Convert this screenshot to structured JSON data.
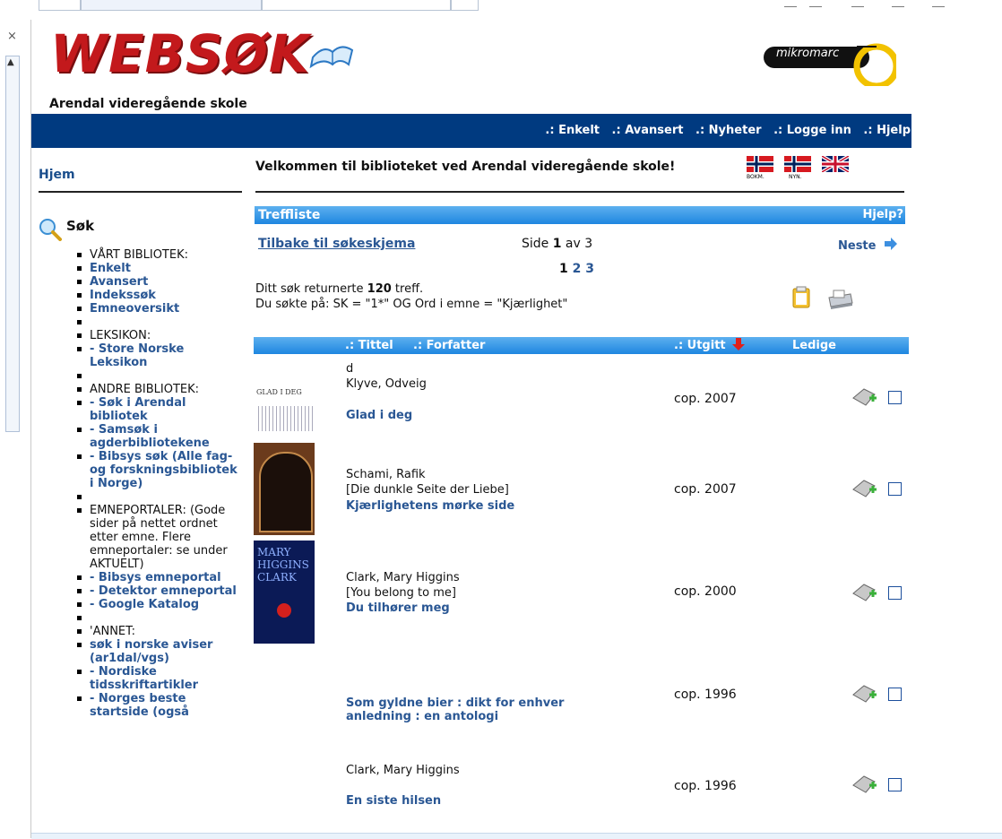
{
  "header": {
    "logo_text": "WEBSØK",
    "school_name": "Arendal videregående skole",
    "vendor_logo_text": "mikromarc"
  },
  "nav": {
    "items": [
      ".: Enkelt",
      ".: Avansert",
      ".: Nyheter",
      ".: Logge inn",
      ".: Hjelp"
    ]
  },
  "sidebar": {
    "home": "Hjem",
    "search_title": "Søk",
    "items": [
      {
        "label": "VÅRT BIBLIOTEK:",
        "kind": "text"
      },
      {
        "label": "Enkelt",
        "kind": "link"
      },
      {
        "label": "Avansert",
        "kind": "link"
      },
      {
        "label": "Indekssøk",
        "kind": "link"
      },
      {
        "label": "Emneoversikt",
        "kind": "link"
      },
      {
        "label": "",
        "kind": "blank"
      },
      {
        "label": "LEKSIKON:",
        "kind": "text"
      },
      {
        "label": "- Store Norske Leksikon",
        "kind": "link"
      },
      {
        "label": "",
        "kind": "blank"
      },
      {
        "label": "ANDRE BIBLIOTEK:",
        "kind": "text"
      },
      {
        "label": "- Søk i Arendal bibliotek",
        "kind": "link"
      },
      {
        "label": "- Samsøk i agderbibliotekene",
        "kind": "link"
      },
      {
        "label": "- Bibsys søk (Alle fag- og forskningsbibliotek i Norge)",
        "kind": "link"
      },
      {
        "label": "",
        "kind": "blank"
      },
      {
        "label": "EMNEPORTALER: (Gode sider på nettet ordnet etter emne. Flere emneportaler: se under AKTUELT)",
        "kind": "text"
      },
      {
        "label": "- Bibsys emneportal",
        "kind": "link"
      },
      {
        "label": "- Detektor emneportal",
        "kind": "link"
      },
      {
        "label": "- Google Katalog",
        "kind": "link"
      },
      {
        "label": "",
        "kind": "blank"
      },
      {
        "label": "'ANNET:",
        "kind": "text"
      },
      {
        "label": "søk i norske aviser (ar1dal/vgs)",
        "kind": "link"
      },
      {
        "label": "- Nordiske tidsskriftartikler",
        "kind": "link"
      },
      {
        "label": "- Norges beste startside (også",
        "kind": "link"
      }
    ]
  },
  "main": {
    "welcome": "Velkommen til biblioteket ved Arendal videregående skole!",
    "flag_labels": [
      "BOKM.",
      "NYN."
    ],
    "treffliste_title": "Treffliste",
    "help_link": "Hjelp?",
    "back_link": "Tilbake til søkeskjema",
    "page_prefix": "Side ",
    "page_current": "1",
    "page_suffix": " av 3",
    "next_link": "Neste",
    "pages": [
      "1",
      "2",
      "3"
    ],
    "result_count_prefix": "Ditt søk returnerte ",
    "result_count": "120",
    "result_count_suffix": " treff.",
    "query_text": "Du søkte på: SK = \"1*\" OG Ord i emne = \"Kjærlighet\"",
    "columns": {
      "title": ".: Tittel",
      "author": ".: Forfatter",
      "published": ".: Utgitt",
      "available": "Ledige"
    }
  },
  "results": [
    {
      "lines": [
        "d",
        "Klyve, Odveig"
      ],
      "title": "Glad i deg",
      "year": "cop. 2007",
      "cover_text": "GLAD I DEG"
    },
    {
      "lines": [
        "Schami, Rafik",
        "[Die dunkle Seite der Liebe]"
      ],
      "title": "Kjærlighetens mørke side",
      "year": "cop. 2007",
      "cover_text": ""
    },
    {
      "lines": [
        "Clark, Mary Higgins",
        "[You belong to me]"
      ],
      "title": "Du tilhører meg",
      "year": "cop. 2000",
      "cover_text": "MARY HIGGINS CLARK"
    },
    {
      "lines": [],
      "title": "Som gyldne bier : dikt for enhver anledning : en antologi",
      "year": "cop. 1996",
      "cover_text": ""
    },
    {
      "lines": [
        "Clark, Mary Higgins"
      ],
      "title": "En siste hilsen",
      "year": "cop. 1996",
      "cover_text": ""
    }
  ],
  "colors": {
    "navbar": "#003a80",
    "accent_bar": "#1e86e0",
    "link": "#2a5794",
    "logo_red": "#c3191c"
  }
}
